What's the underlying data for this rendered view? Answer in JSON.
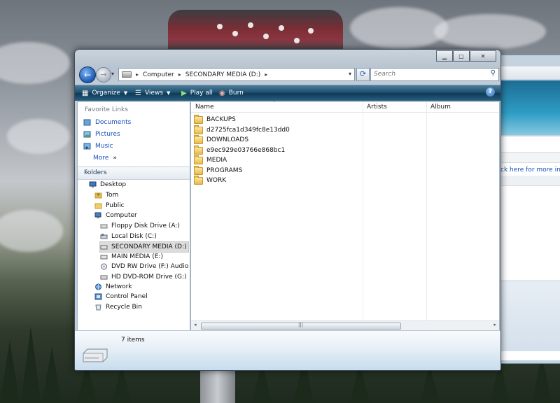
{
  "window": {
    "address": {
      "crumbs": [
        "Computer",
        "SECONDARY MEDIA (D:)"
      ]
    },
    "search": {
      "placeholder": "Search"
    }
  },
  "toolbar": {
    "organize": "Organize",
    "views": "Views",
    "play_all": "Play all",
    "burn": "Burn"
  },
  "favorites": {
    "title": "Favorite Links",
    "items": [
      "Documents",
      "Pictures",
      "Music"
    ],
    "more": "More"
  },
  "folders": {
    "title": "Folders",
    "tree": [
      "Desktop",
      "Tom",
      "Public",
      "Computer",
      "Floppy Disk Drive (A:)",
      "Local Disk (C:)",
      "SECONDARY MEDIA (D:)",
      "MAIN MEDIA (E:)",
      "DVD RW Drive (F:) Audio CD",
      "HD DVD-ROM Drive (G:)",
      "Network",
      "Control Panel",
      "Recycle Bin"
    ]
  },
  "files": {
    "columns": [
      "Name",
      "Artists",
      "Album"
    ],
    "items": [
      "BACKUPS",
      "d2725fca1d349fc8e13dd0",
      "DOWNLOADS",
      "e9ec929e03766e868bc1",
      "MEDIA",
      "PROGRAMS",
      "WORK"
    ]
  },
  "details": {
    "count": "7 items"
  },
  "background_window": {
    "link_text": "ck here for more infor"
  },
  "colors": {
    "accent": "#1f5fb8",
    "toolbar": "#1c4d6c",
    "link": "#1a50b8",
    "folder": "#e7b94c"
  }
}
